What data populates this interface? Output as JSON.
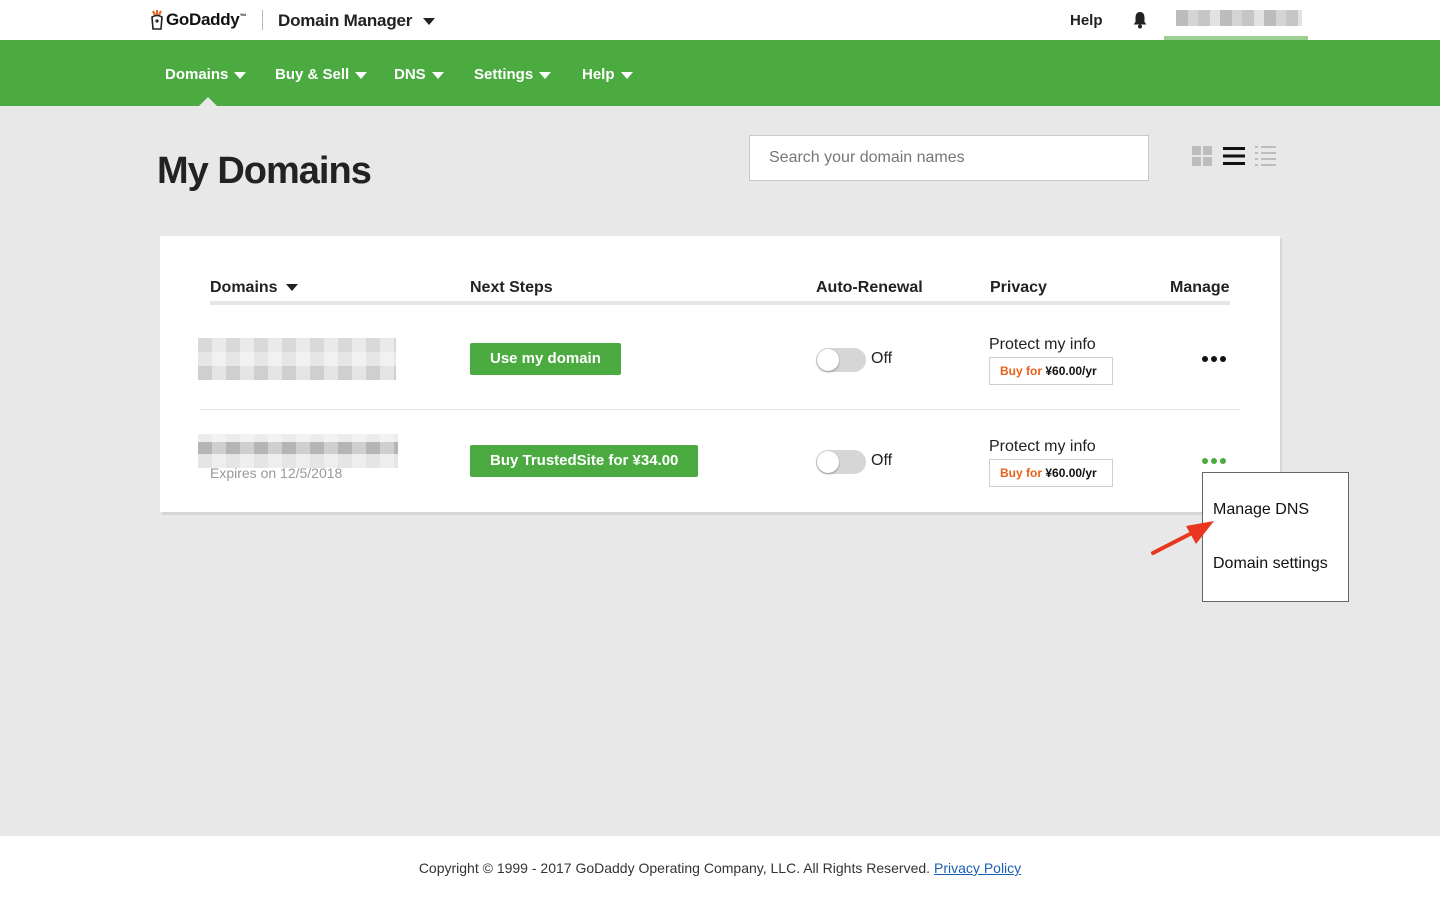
{
  "header": {
    "logo_text": "GoDaddy",
    "logo_tm": "™",
    "app_name": "Domain Manager",
    "help_label": "Help"
  },
  "nav": {
    "items": [
      {
        "label": "Domains"
      },
      {
        "label": "Buy & Sell"
      },
      {
        "label": "DNS"
      },
      {
        "label": "Settings"
      },
      {
        "label": "Help"
      }
    ]
  },
  "page": {
    "title": "My Domains",
    "search_placeholder": "Search your domain names"
  },
  "table": {
    "columns": [
      "Domains",
      "Next Steps",
      "Auto-Renewal",
      "Privacy",
      "Manage"
    ],
    "rows": [
      {
        "next_step": "Use my domain",
        "auto_renewal": "Off",
        "privacy_label": "Protect my info",
        "buy_for": "Buy for",
        "price": "¥60.00/yr"
      },
      {
        "expires": "Expires on 12/5/2018",
        "next_step": "Buy TrustedSite for ¥34.00",
        "auto_renewal": "Off",
        "privacy_label": "Protect my info",
        "buy_for": "Buy for",
        "price": "¥60.00/yr"
      }
    ]
  },
  "manage_menu": {
    "items": [
      "Manage DNS",
      "Domain settings"
    ]
  },
  "footer": {
    "copyright": "Copyright © 1999 - 2017 GoDaddy Operating Company, LLC. All Rights Reserved.",
    "privacy_link": "Privacy Policy"
  },
  "colors": {
    "brand_green": "#4bab41",
    "buy_orange": "#e8611a",
    "annotation_arrow": "#e8361f"
  },
  "icons": [
    "godaddy-logo-icon",
    "chevron-down-icon",
    "bell-icon",
    "grid-view-icon",
    "list-view-icon",
    "compact-list-icon",
    "more-dots-icon",
    "annotation-arrow-icon"
  ]
}
